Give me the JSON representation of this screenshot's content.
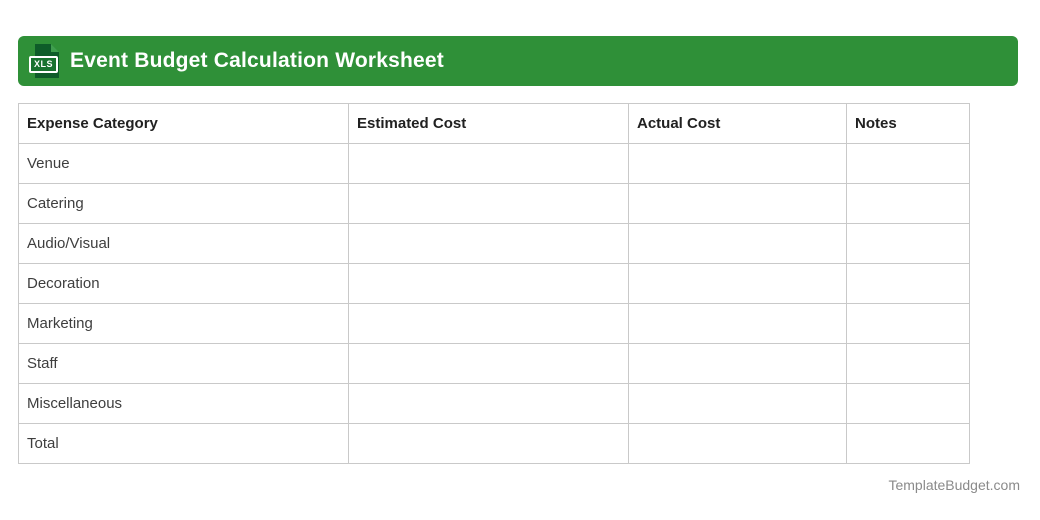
{
  "header": {
    "title": "Event Budget Calculation Worksheet",
    "file_badge": "XLS",
    "bar_color": "#2f9038",
    "icon_color": "#0e5c29"
  },
  "table": {
    "border_color": "#c9c9c9",
    "columns": [
      "Expense Category",
      "Estimated Cost",
      "Actual Cost",
      "Notes"
    ],
    "rows": [
      {
        "category": "Venue",
        "estimated_cost": "",
        "actual_cost": "",
        "notes": ""
      },
      {
        "category": "Catering",
        "estimated_cost": "",
        "actual_cost": "",
        "notes": ""
      },
      {
        "category": "Audio/Visual",
        "estimated_cost": "",
        "actual_cost": "",
        "notes": ""
      },
      {
        "category": "Decoration",
        "estimated_cost": "",
        "actual_cost": "",
        "notes": ""
      },
      {
        "category": "Marketing",
        "estimated_cost": "",
        "actual_cost": "",
        "notes": ""
      },
      {
        "category": "Staff",
        "estimated_cost": "",
        "actual_cost": "",
        "notes": ""
      },
      {
        "category": "Miscellaneous",
        "estimated_cost": "",
        "actual_cost": "",
        "notes": ""
      },
      {
        "category": "Total",
        "estimated_cost": "",
        "actual_cost": "",
        "notes": ""
      }
    ]
  },
  "footer": {
    "brand": "TemplateBudget.com",
    "text_color": "#8a8a8a"
  }
}
